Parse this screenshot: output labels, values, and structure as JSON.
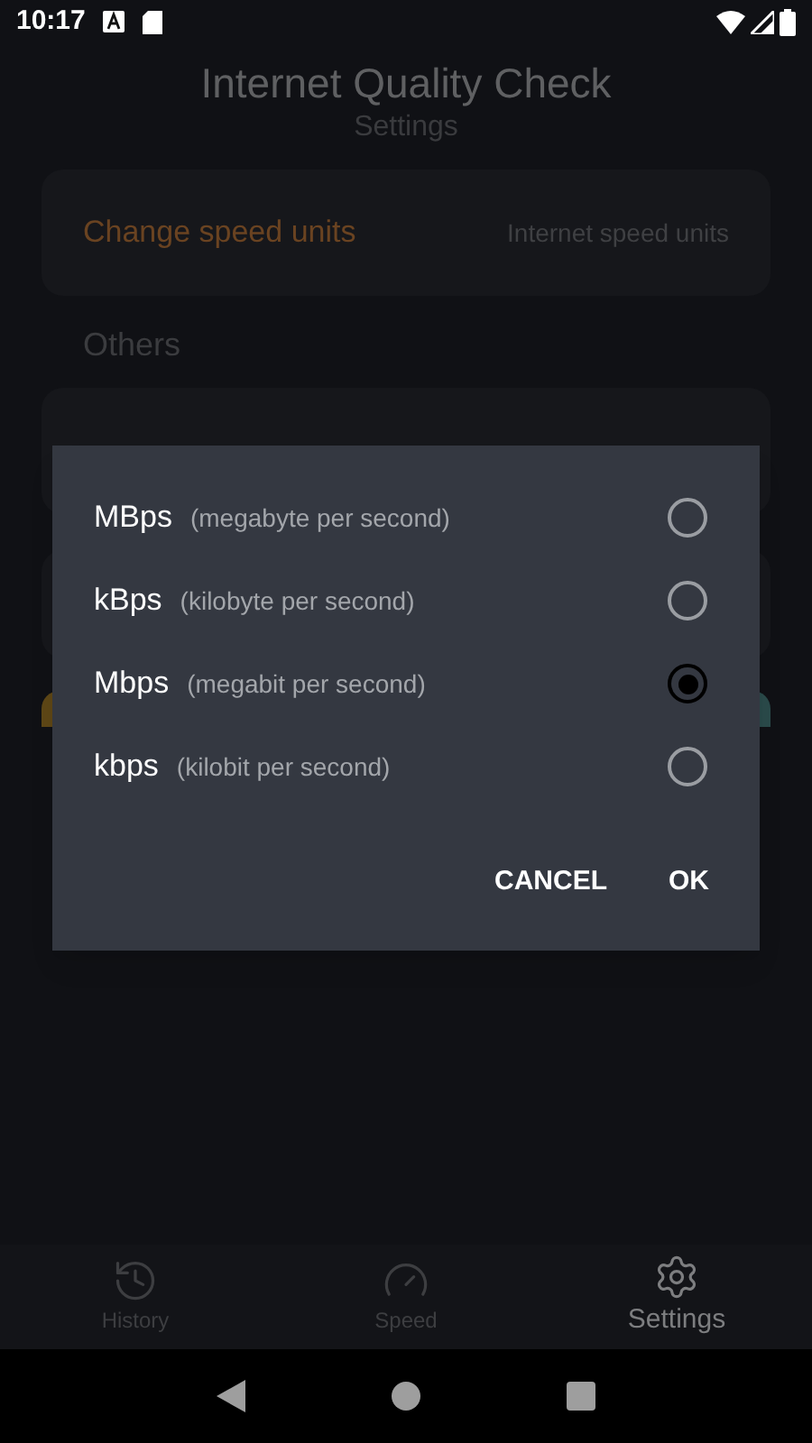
{
  "status_bar": {
    "time": "10:17"
  },
  "header": {
    "title": "Internet Quality Check",
    "subtitle": "Settings"
  },
  "settings": [
    {
      "label": "Change speed units",
      "value": "Internet speed units"
    }
  ],
  "section": "Others",
  "dialog": {
    "options": [
      {
        "unit": "MBps",
        "description": "(megabyte per second)",
        "selected": false
      },
      {
        "unit": "kBps",
        "description": "(kilobyte per second)",
        "selected": false
      },
      {
        "unit": "Mbps",
        "description": "(megabit per second)",
        "selected": true
      },
      {
        "unit": "kbps",
        "description": "(kilobit per second)",
        "selected": false
      }
    ],
    "buttons": [
      "CANCEL",
      "OK"
    ]
  },
  "bottom_nav": [
    {
      "label": "History",
      "selected": false
    },
    {
      "label": "Speed",
      "selected": false
    },
    {
      "label": "Settings",
      "selected": true
    }
  ]
}
